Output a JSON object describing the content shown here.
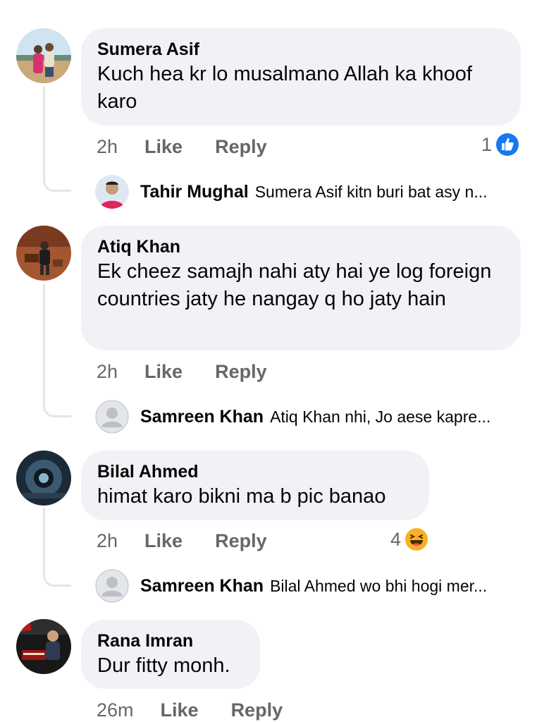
{
  "colors": {
    "bubble": "#f0f2f5",
    "meta_text": "#65676b",
    "like_blue": "#1877f2",
    "haha_yellow": "#f7b125",
    "thread_line": "#e4e6eb"
  },
  "comments": [
    {
      "author": "Sumera Asif",
      "text": "Kuch hea kr lo musalmano Allah  ka khoof karo",
      "time": "2h",
      "like": "Like",
      "reply": "Reply",
      "reaction": {
        "count": "1",
        "icon": "like-icon"
      },
      "reply_preview": {
        "author": "Tahir Mughal",
        "text": "Sumera Asif kitn buri bat asy n..."
      }
    },
    {
      "author": "Atiq Khan",
      "text": "Ek cheez samajh nahi aty hai ye log foreign countries jaty he nangay q ho jaty hain",
      "time": "2h",
      "like": "Like",
      "reply": "Reply",
      "reply_preview": {
        "author": "Samreen Khan",
        "text": "Atiq Khan nhi, Jo aese kapre..."
      }
    },
    {
      "author": "Bilal Ahmed",
      "text": "himat karo bikni ma b pic banao",
      "time": "2h",
      "like": "Like",
      "reply": "Reply",
      "reaction": {
        "count": "4",
        "icon": "haha-icon"
      },
      "reply_preview": {
        "author": "Samreen Khan",
        "text": "Bilal Ahmed wo bhi hogi mer..."
      }
    },
    {
      "author": "Rana Imran",
      "text": "Dur fitty monh.",
      "time": "26m",
      "like": "Like",
      "reply": "Reply"
    }
  ]
}
